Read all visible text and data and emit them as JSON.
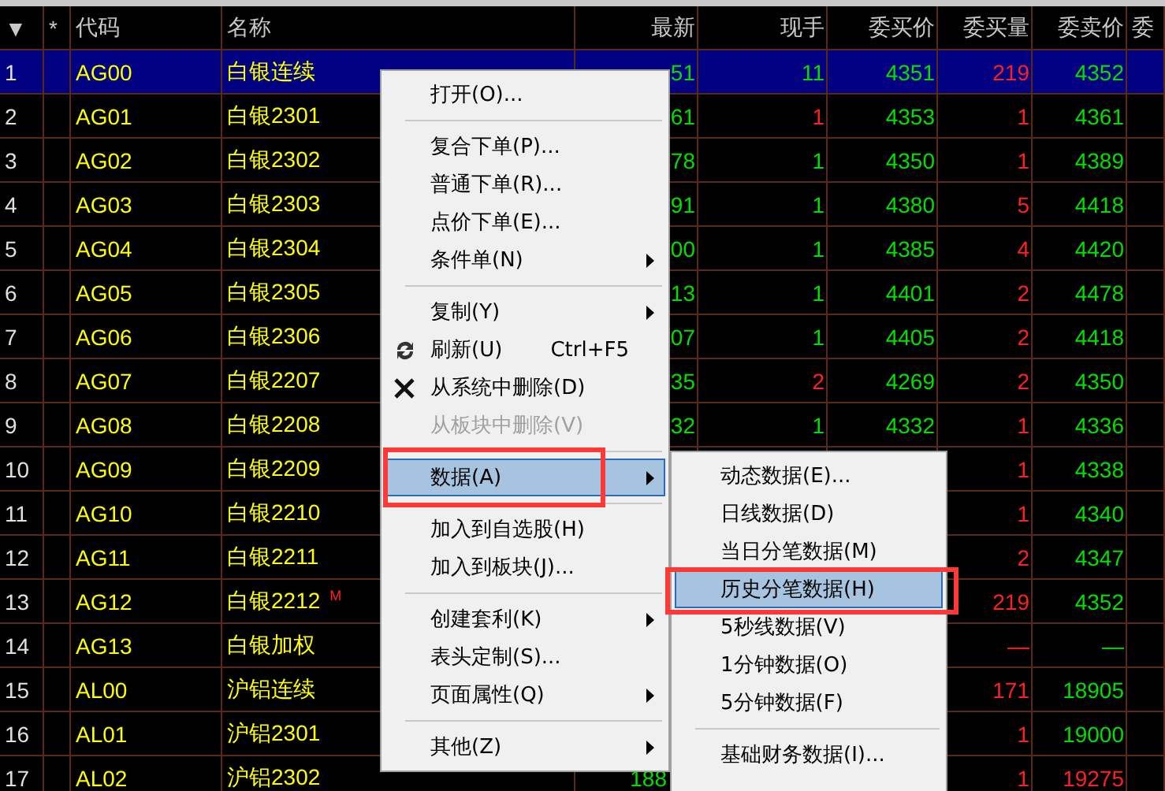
{
  "table": {
    "columns": [
      "▼",
      "*",
      "代码",
      "名称",
      "最新",
      "现手",
      "委买价",
      "委买量",
      "委卖价",
      "委"
    ],
    "rows": [
      {
        "index": "1",
        "code": "AG00",
        "name": "白银连续",
        "selected": true,
        "latest": {
          "text": "51",
          "color": "#00e000"
        },
        "volume": {
          "text": "11",
          "color": "#00e000"
        },
        "bid": {
          "text": "4351",
          "color": "#00e000"
        },
        "bid_qty": {
          "text": "219",
          "color": "#ff2020"
        },
        "ask": {
          "text": "4352",
          "color": "#00e000"
        }
      },
      {
        "index": "2",
        "code": "AG01",
        "name": "白银2301",
        "selected": false,
        "latest": {
          "text": "61",
          "color": "#00e000"
        },
        "volume": {
          "text": "1",
          "color": "#ff2020"
        },
        "bid": {
          "text": "4353",
          "color": "#00e000"
        },
        "bid_qty": {
          "text": "1",
          "color": "#ff2020"
        },
        "ask": {
          "text": "4361",
          "color": "#00e000"
        }
      },
      {
        "index": "3",
        "code": "AG02",
        "name": "白银2302",
        "selected": false,
        "latest": {
          "text": "78",
          "color": "#00e000"
        },
        "volume": {
          "text": "1",
          "color": "#00e000"
        },
        "bid": {
          "text": "4350",
          "color": "#00e000"
        },
        "bid_qty": {
          "text": "1",
          "color": "#ff2020"
        },
        "ask": {
          "text": "4389",
          "color": "#00e000"
        }
      },
      {
        "index": "4",
        "code": "AG03",
        "name": "白银2303",
        "selected": false,
        "latest": {
          "text": "91",
          "color": "#00e000"
        },
        "volume": {
          "text": "1",
          "color": "#00e000"
        },
        "bid": {
          "text": "4380",
          "color": "#00e000"
        },
        "bid_qty": {
          "text": "5",
          "color": "#ff2020"
        },
        "ask": {
          "text": "4418",
          "color": "#00e000"
        }
      },
      {
        "index": "5",
        "code": "AG04",
        "name": "白银2304",
        "selected": false,
        "latest": {
          "text": "00",
          "color": "#00e000"
        },
        "volume": {
          "text": "1",
          "color": "#00e000"
        },
        "bid": {
          "text": "4385",
          "color": "#00e000"
        },
        "bid_qty": {
          "text": "4",
          "color": "#ff2020"
        },
        "ask": {
          "text": "4420",
          "color": "#00e000"
        }
      },
      {
        "index": "6",
        "code": "AG05",
        "name": "白银2305",
        "selected": false,
        "latest": {
          "text": "13",
          "color": "#00e000"
        },
        "volume": {
          "text": "1",
          "color": "#00e000"
        },
        "bid": {
          "text": "4401",
          "color": "#00e000"
        },
        "bid_qty": {
          "text": "2",
          "color": "#ff2020"
        },
        "ask": {
          "text": "4478",
          "color": "#00e000"
        }
      },
      {
        "index": "7",
        "code": "AG06",
        "name": "白银2306",
        "selected": false,
        "latest": {
          "text": "07",
          "color": "#00e000"
        },
        "volume": {
          "text": "1",
          "color": "#00e000"
        },
        "bid": {
          "text": "4405",
          "color": "#00e000"
        },
        "bid_qty": {
          "text": "2",
          "color": "#ff2020"
        },
        "ask": {
          "text": "4418",
          "color": "#00e000"
        }
      },
      {
        "index": "8",
        "code": "AG07",
        "name": "白银2207",
        "selected": false,
        "latest": {
          "text": "35",
          "color": "#00e000"
        },
        "volume": {
          "text": "2",
          "color": "#ff2020"
        },
        "bid": {
          "text": "4269",
          "color": "#00e000"
        },
        "bid_qty": {
          "text": "2",
          "color": "#ff2020"
        },
        "ask": {
          "text": "4350",
          "color": "#00e000"
        }
      },
      {
        "index": "9",
        "code": "AG08",
        "name": "白银2208",
        "selected": false,
        "latest": {
          "text": "32",
          "color": "#00e000"
        },
        "volume": {
          "text": "1",
          "color": "#00e000"
        },
        "bid": {
          "text": "4332",
          "color": "#00e000"
        },
        "bid_qty": {
          "text": "1",
          "color": "#ff2020"
        },
        "ask": {
          "text": "4336",
          "color": "#00e000"
        }
      },
      {
        "index": "10",
        "code": "AG09",
        "name": "白银2209",
        "selected": false,
        "bid_qty": {
          "text": "1",
          "color": "#ff2020"
        },
        "ask": {
          "text": "4338",
          "color": "#00e000"
        }
      },
      {
        "index": "11",
        "code": "AG10",
        "name": "白银2210",
        "selected": false,
        "bid_qty": {
          "text": "1",
          "color": "#ff2020"
        },
        "ask": {
          "text": "4340",
          "color": "#00e000"
        }
      },
      {
        "index": "12",
        "code": "AG11",
        "name": "白银2211",
        "selected": false,
        "bid_qty": {
          "text": "2",
          "color": "#ff2020"
        },
        "ask": {
          "text": "4347",
          "color": "#00e000"
        }
      },
      {
        "index": "13",
        "code": "AG12",
        "name": "白银2212",
        "marker": "M",
        "selected": false,
        "bid_qty": {
          "text": "219",
          "color": "#ff2020"
        },
        "ask": {
          "text": "4352",
          "color": "#00e000"
        }
      },
      {
        "index": "14",
        "code": "AG13",
        "name": "白银加权",
        "selected": false,
        "bid_qty": {
          "text": "—",
          "color": "#ff2020"
        },
        "ask": {
          "text": "—",
          "color": "#00e000"
        }
      },
      {
        "index": "15",
        "code": "AL00",
        "name": "沪铝连续",
        "selected": false,
        "bid_qty": {
          "text": "171",
          "color": "#ff2020"
        },
        "ask": {
          "text": "18905",
          "color": "#00e000"
        }
      },
      {
        "index": "16",
        "code": "AL01",
        "name": "沪铝2301",
        "selected": false,
        "bid_qty": {
          "text": "1",
          "color": "#ff2020"
        },
        "ask": {
          "text": "19000",
          "color": "#00e000"
        }
      },
      {
        "index": "17",
        "code": "AL02",
        "name": "沪铝2302",
        "selected": false,
        "latest": {
          "text": "188",
          "color": "#00e000",
          "partial": true
        },
        "bid_qty": {
          "text": "1",
          "color": "#ff2020"
        },
        "ask": {
          "text": "19275",
          "color": "#ff2020"
        }
      }
    ]
  },
  "context_menu": {
    "items": [
      {
        "kind": "item",
        "label": "打开(O)...",
        "selected": false
      },
      {
        "kind": "separator"
      },
      {
        "kind": "item",
        "label": "复合下单(P)...",
        "selected": false
      },
      {
        "kind": "item",
        "label": "普通下单(R)...",
        "selected": false
      },
      {
        "kind": "item",
        "label": "点价下单(E)...",
        "selected": false
      },
      {
        "kind": "item",
        "label": "条件单(N)",
        "submenu": true,
        "selected": false
      },
      {
        "kind": "separator"
      },
      {
        "kind": "item",
        "label": "复制(Y)",
        "submenu": true,
        "selected": false
      },
      {
        "kind": "refresh",
        "label": "刷新(U)",
        "shortcut": "Ctrl+F5",
        "selected": false
      },
      {
        "kind": "delete",
        "label": "从系统中删除(D)",
        "selected": false
      },
      {
        "kind": "item",
        "label": "从板块中删除(V)",
        "disabled": true,
        "selected": false
      },
      {
        "kind": "separator"
      },
      {
        "kind": "item",
        "label": "数据(A)",
        "submenu": true,
        "selected": true,
        "annotated": true
      },
      {
        "kind": "separator"
      },
      {
        "kind": "item",
        "label": "加入到自选股(H)",
        "selected": false
      },
      {
        "kind": "item",
        "label": "加入到板块(J)...",
        "selected": false
      },
      {
        "kind": "separator"
      },
      {
        "kind": "item",
        "label": "创建套利(K)",
        "submenu": true,
        "selected": false
      },
      {
        "kind": "item",
        "label": "表头定制(S)...",
        "selected": false
      },
      {
        "kind": "item",
        "label": "页面属性(Q)",
        "submenu": true,
        "selected": false
      },
      {
        "kind": "separator"
      },
      {
        "kind": "item",
        "label": "其他(Z)",
        "submenu": true,
        "selected": false
      }
    ]
  },
  "submenu": {
    "items": [
      {
        "kind": "item",
        "label": "动态数据(E)...",
        "selected": false
      },
      {
        "kind": "item",
        "label": "日线数据(D)",
        "selected": false
      },
      {
        "kind": "item",
        "label": "当日分笔数据(M)",
        "selected": false
      },
      {
        "kind": "item",
        "label": "历史分笔数据(H)",
        "selected": true,
        "annotated": true
      },
      {
        "kind": "item",
        "label": "5秒线数据(V)",
        "selected": false
      },
      {
        "kind": "item",
        "label": "1分钟数据(O)",
        "selected": false
      },
      {
        "kind": "item",
        "label": "5分钟数据(F)",
        "selected": false
      },
      {
        "kind": "separator"
      },
      {
        "kind": "item",
        "label": "基础财务数据(I)...",
        "selected": false
      }
    ]
  }
}
